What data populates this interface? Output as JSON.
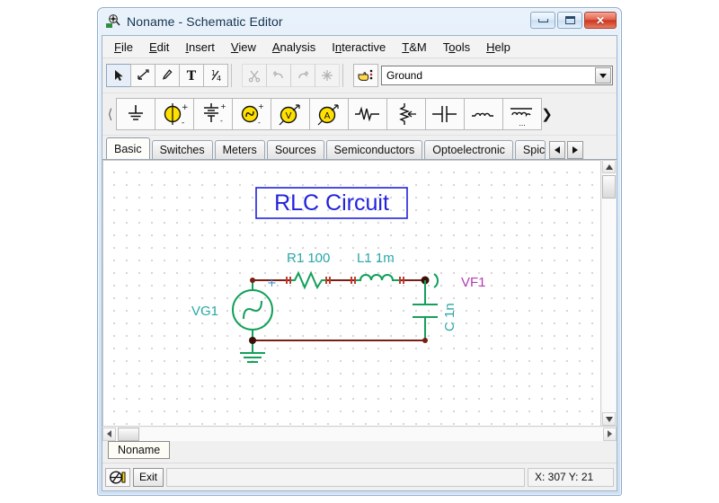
{
  "window": {
    "title": "Noname - Schematic Editor",
    "app_icon": "schematic-app-icon",
    "minimize_label": "Minimize",
    "maximize_label": "Maximize",
    "close_label": "✕"
  },
  "menubar": [
    {
      "label": "File",
      "mnemonic": "F"
    },
    {
      "label": "Edit",
      "mnemonic": "E"
    },
    {
      "label": "Insert",
      "mnemonic": "I"
    },
    {
      "label": "View",
      "mnemonic": "V"
    },
    {
      "label": "Analysis",
      "mnemonic": "A"
    },
    {
      "label": "Interactive",
      "mnemonic": "n"
    },
    {
      "label": "T&M",
      "mnemonic": "T"
    },
    {
      "label": "Tools",
      "mnemonic": "o"
    },
    {
      "label": "Help",
      "mnemonic": "H"
    }
  ],
  "toolbar": {
    "buttons": [
      {
        "icon": "cursor-arrow-icon",
        "state": "pressed"
      },
      {
        "icon": "wire-draw-icon",
        "state": "normal"
      },
      {
        "icon": "pen-icon",
        "state": "normal"
      },
      {
        "icon": "text-tool-icon",
        "state": "normal"
      },
      {
        "icon": "scale-ratio-icon",
        "state": "normal"
      },
      {
        "icon": "cut-scissors-icon",
        "state": "disabled"
      },
      {
        "icon": "undo-icon",
        "state": "disabled"
      },
      {
        "icon": "redo-icon",
        "state": "disabled"
      },
      {
        "icon": "snap-star-icon",
        "state": "disabled"
      }
    ],
    "place_icon": "hand-place-icon",
    "component_select": {
      "value": "Ground",
      "placeholder": "Ground"
    }
  },
  "component_toolbar": {
    "left_arrow": "‹",
    "right_arrow": "❯",
    "items": [
      {
        "icon": "ground-symbol-icon",
        "name": "Ground"
      },
      {
        "icon": "dc-source-icon",
        "name": "DC Source"
      },
      {
        "icon": "battery-icon",
        "name": "Battery"
      },
      {
        "icon": "ac-source-icon",
        "name": "AC Source"
      },
      {
        "icon": "voltmeter-icon",
        "name": "Voltmeter"
      },
      {
        "icon": "ammeter-icon",
        "name": "Ammeter"
      },
      {
        "icon": "resistor-icon",
        "name": "Resistor"
      },
      {
        "icon": "potentiometer-icon",
        "name": "Potentiometer"
      },
      {
        "icon": "capacitor-icon",
        "name": "Capacitor"
      },
      {
        "icon": "inductor-icon",
        "name": "Inductor"
      },
      {
        "icon": "transformer-icon",
        "name": "Transformer"
      }
    ]
  },
  "tabs": {
    "items": [
      {
        "label": "Basic",
        "active": true
      },
      {
        "label": "Switches",
        "active": false
      },
      {
        "label": "Meters",
        "active": false
      },
      {
        "label": "Sources",
        "active": false
      },
      {
        "label": "Semiconductors",
        "active": false
      },
      {
        "label": "Optoelectronic",
        "active": false
      },
      {
        "label": "Spice",
        "active": false,
        "clipped": true
      }
    ]
  },
  "schematic": {
    "title_text": "RLC Circuit",
    "title_color": "#2222dd",
    "labels": {
      "source": "VG1",
      "resistor": "R1 100",
      "inductor": "L1 1m",
      "capacitor": "C 1n",
      "probe": "VF1"
    },
    "colors": {
      "component": "#13a05a",
      "wire": "#7b1f14",
      "label": "#2aa8a8",
      "probe": "#b43cb4",
      "junction": "#3a1008",
      "plus_marker": "#3b8fd4"
    }
  },
  "document_tab": {
    "label": "Noname"
  },
  "statusbar": {
    "probe_icon": "probe-tool-icon",
    "exit_label": "Exit",
    "message": "",
    "coordinates": "X: 307  Y: 21"
  }
}
